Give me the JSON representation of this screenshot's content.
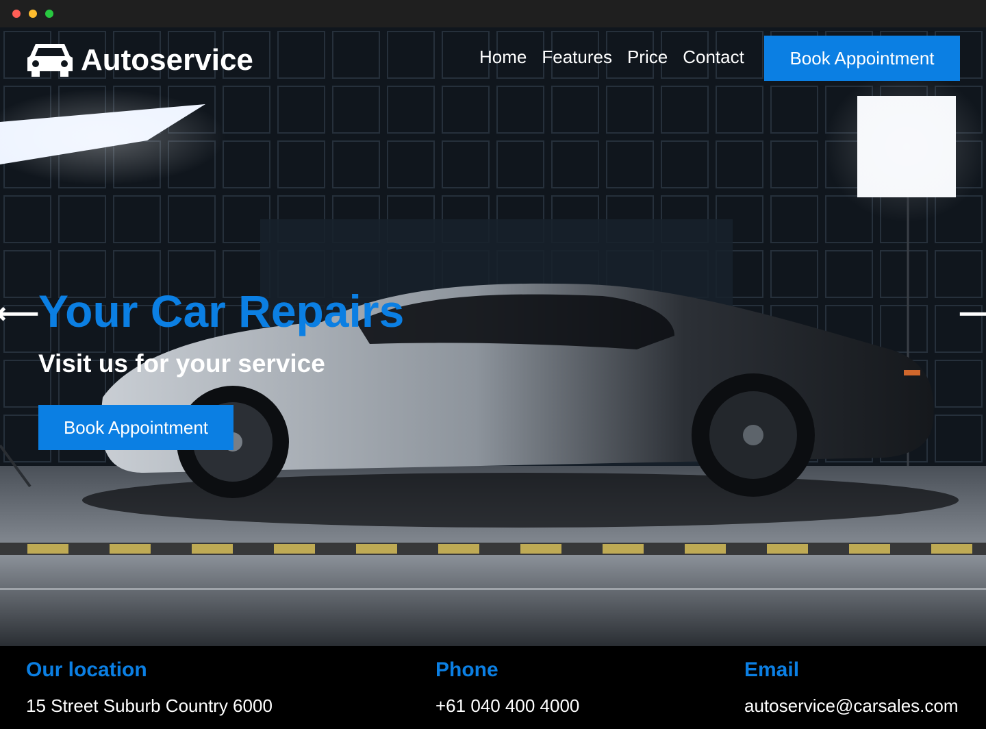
{
  "window": {
    "controls": [
      "close",
      "minimize",
      "maximize"
    ]
  },
  "brand": {
    "name": "Autoservice",
    "icon": "car-icon"
  },
  "nav": {
    "items": [
      "Home",
      "Features",
      "Price",
      "Contact"
    ]
  },
  "header_cta": "Book Appointment",
  "hero": {
    "title": "Your Car Repairs",
    "subtitle": "Visit us for your service",
    "cta": "Book Appointment",
    "prev_icon": "arrow-left-icon",
    "next_icon": "arrow-right-icon"
  },
  "contact": {
    "location": {
      "label": "Our location",
      "value": "15 Street Suburb Country 6000"
    },
    "phone": {
      "label": "Phone",
      "value": "+61 040 400 4000"
    },
    "email": {
      "label": "Email",
      "value": "autoservice@carsales.com"
    }
  },
  "colors": {
    "accent": "#0b7fe3",
    "footer_bg": "#000000",
    "text": "#ffffff"
  }
}
